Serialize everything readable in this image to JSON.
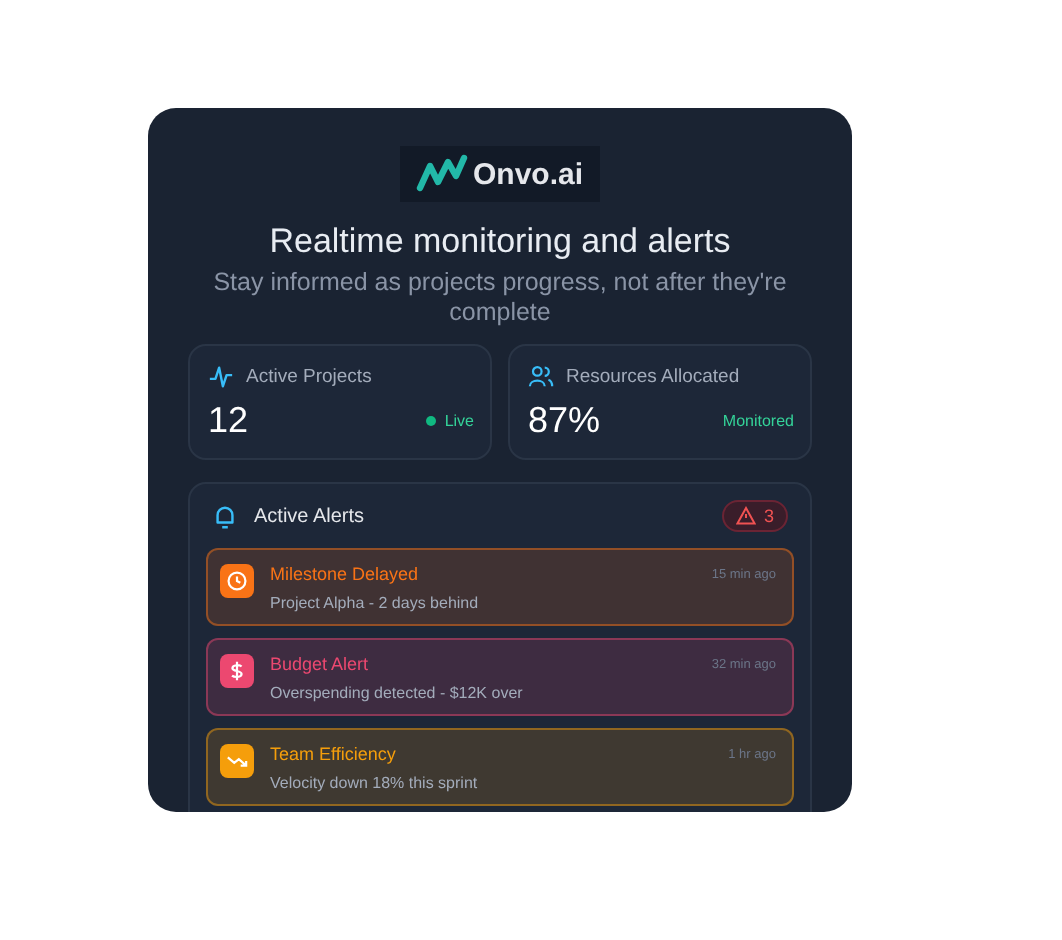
{
  "logo": {
    "text": "Onvo.ai"
  },
  "title": "Realtime monitoring and alerts",
  "subtitle": "Stay informed as projects progress, not after they're complete",
  "stats": [
    {
      "kind": "activity",
      "label": "Active Projects",
      "value": "12",
      "status": "Live",
      "live_dot": true
    },
    {
      "kind": "users",
      "label": "Resources Allocated",
      "value": "87%",
      "status": "Monitored",
      "live_dot": false
    }
  ],
  "alerts_panel": {
    "title": "Active Alerts",
    "count": "3",
    "alerts": [
      {
        "kind": "clock",
        "color": "#f97316",
        "title": "Milestone Delayed",
        "detail": "Project Alpha - 2 days behind",
        "time": "15 min ago"
      },
      {
        "kind": "dollar",
        "color": "#ec4870",
        "title": "Budget Alert",
        "detail": "Overspending detected - $12K over",
        "time": "32 min ago"
      },
      {
        "kind": "trend",
        "color": "#f59e0b",
        "title": "Team Efficiency",
        "detail": "Velocity down 18% this sprint",
        "time": "1 hr ago"
      }
    ]
  }
}
